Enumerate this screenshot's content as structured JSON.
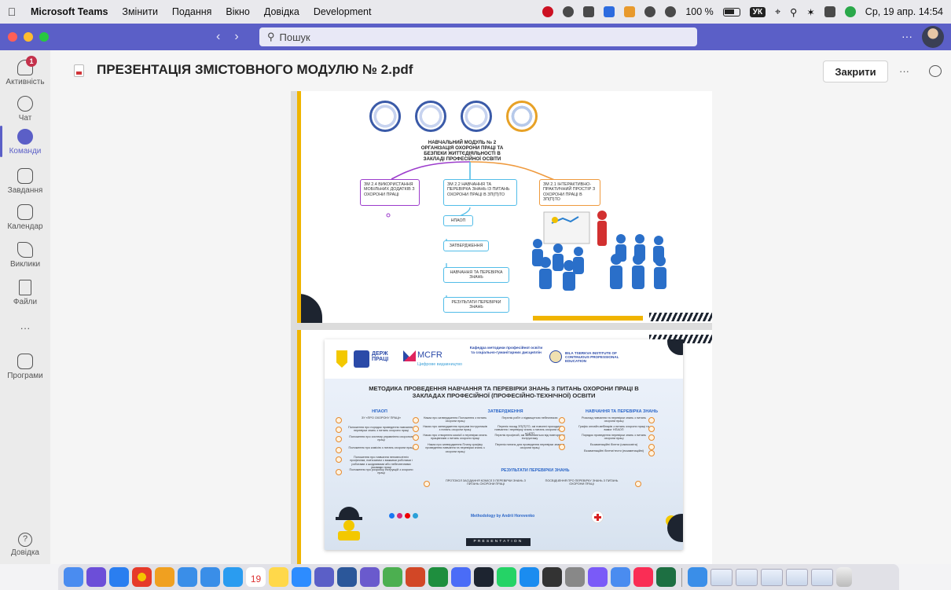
{
  "menubar": {
    "app_name": "Microsoft Teams",
    "items": [
      "Змінити",
      "Подання",
      "Вікно",
      "Довідка",
      "Development"
    ],
    "battery": "100 %",
    "keyboard": "УК",
    "datetime": "Ср, 19 апр.  14:54"
  },
  "titlebar": {
    "search_placeholder": "Пошук",
    "more": "···"
  },
  "rail": {
    "activity": {
      "label": "Активність",
      "badge": "1"
    },
    "chat": "Чат",
    "teams": "Команди",
    "assignments": "Завдання",
    "calendar": "Календар",
    "calls": "Виклики",
    "files": "Файли",
    "more": "···",
    "apps": "Програми",
    "help": "Довідка"
  },
  "document": {
    "title": "ПРЕЗЕНТАЦІЯ ЗМІСТОВНОГО МОДУЛЮ № 2.pdf",
    "close_label": "Закрити",
    "more": "···"
  },
  "page1": {
    "mindmap_title": "НАВЧАЛЬНИЙ МОДУЛЬ № 2 ОРГАНІЗАЦІЯ ОХОРОНИ ПРАЦІ ТА БЕЗПЕКИ ЖИТТЄДІЯЛЬНОСТІ В ЗАКЛАДІ ПРОФЕСІЙНОЇ ОСВІТИ",
    "box_left": "ЗМ 2.4 ВИКОРИСТАННЯ МОБІЛЬНИХ ДОДАТКІВ З ОХОРОНИ ПРАЦІ",
    "box_center": "ЗМ 2.2 НАВЧАННЯ ТА ПЕРЕВІРКА ЗНАНЬ ІЗ ПИТАНЬ ОХОРОНИ ПРАЦІ В ЗП(П)ТО",
    "box_right": "ЗМ 2.1 ІНТЕРАКТИВНО-ПРАКТИЧНИЙ ПРОСТІР З ОХОРОНИ ПРАЦІ В ЗП(П)ТО",
    "sub1": "НПАОП",
    "sub2": "ЗАТВЕРДЖЕННЯ",
    "sub3": "НАВЧАННЯ ТА ПЕРЕВІРКА ЗНАНЬ",
    "sub4": "РЕЗУЛЬТАТИ ПЕРЕВІРКИ ЗНАНЬ"
  },
  "page2": {
    "derzh": "ДЕРЖ ПРАЦІ",
    "mcfr": "MCFR",
    "mcfr_sub": "Цифрове видавництво",
    "kafedra": "Кафедра методики професійної освіти та соціально-гуманітарних дисциплін",
    "bilats": "BILA TSERKVA INSTITUTE OF CONTINUOUS PROFESSIONAL EDUCATION",
    "title": "МЕТОДИКА ПРОВЕДЕННЯ НАВЧАННЯ ТА ПЕРЕВІРКИ ЗНАНЬ З ПИТАНЬ ОХОРОНИ ПРАЦІ В ЗАКЛАДАХ ПРОФЕСІЙНОЇ (ПРОФЕСІЙНО-ТЕХНІЧНОЇ) ОСВІТИ",
    "col1_head": "НПАОП",
    "col2_head": "ЗАТВЕРДЖЕННЯ",
    "col3_head": "НАВЧАННЯ ТА ПЕРЕВІРКА ЗНАНЬ",
    "results_head": "РЕЗУЛЬТАТИ ПЕРЕВІРКИ ЗНАНЬ",
    "col1_items": [
      "ЗУ «ПРО ОХОРОНУ ПРАЦІ»",
      "Положення про порядок проведення навчання і перевірки знань з питань охорони праці",
      "Положення про систему управління охороною праці",
      "Положення про комісію з питань охорони праці",
      "Положення про навчання неповнолітніх професіям, пов'язаним з важкими роботами і роботами з шкідливими або небезпечними умовами праці",
      "Положення про розробку інструкцій з охорони праці"
    ],
    "col2a_items": [
      "Наказ про затвердження Положення з питань охорони праці",
      "Наказ про затвердження програм інструктажів з питань охорони праці",
      "Наказ про створення комісії з перевірки знань працівників з питань охорони праці",
      "Наказ про затвердження Плану-графіку проведення навчання та перевірки знань з охорони праці"
    ],
    "col2b_items": [
      "Перелік робіт з підвищеною небезпекою",
      "Перелік посад ЗП(П)ТО, які повинні проходити навчання і перевірку знань з питань охорони праці в ЦПП",
      "Перелік професій, які звільняються від повторного інструктажу",
      "Перелік питань для проведення перевірки знань з охорони праці"
    ],
    "col3_items": [
      "Розклад навчання та перевірки знань з питань охорони праці",
      "Графік онлайн-вебінарів з питань охорони праці та вимог НПАОП",
      "Порядок проведення перевірки знань з питань охорони праці",
      "Екзаменаційні білети (самоосвіта)",
      "Екзаменаційні білети/тести (екзаменаційні)"
    ],
    "results_left": "ПРОТОКОЛ ЗАСІДАННЯ КОМІСІЇ З ПЕРЕВІРКИ ЗНАНЬ З ПИТАНЬ ОХОРОНИ ПРАЦІ",
    "results_right": "ПОСВІДЧЕННЯ ПРО ПЕРЕВІРКУ ЗНАНЬ З ПИТАНЬ ОХОРОНИ ПРАЦІ",
    "methodology": "Methodology by Andrii Horevenko",
    "presentation": "PRESENTATION"
  },
  "dock": {
    "calendar_date": "19"
  }
}
